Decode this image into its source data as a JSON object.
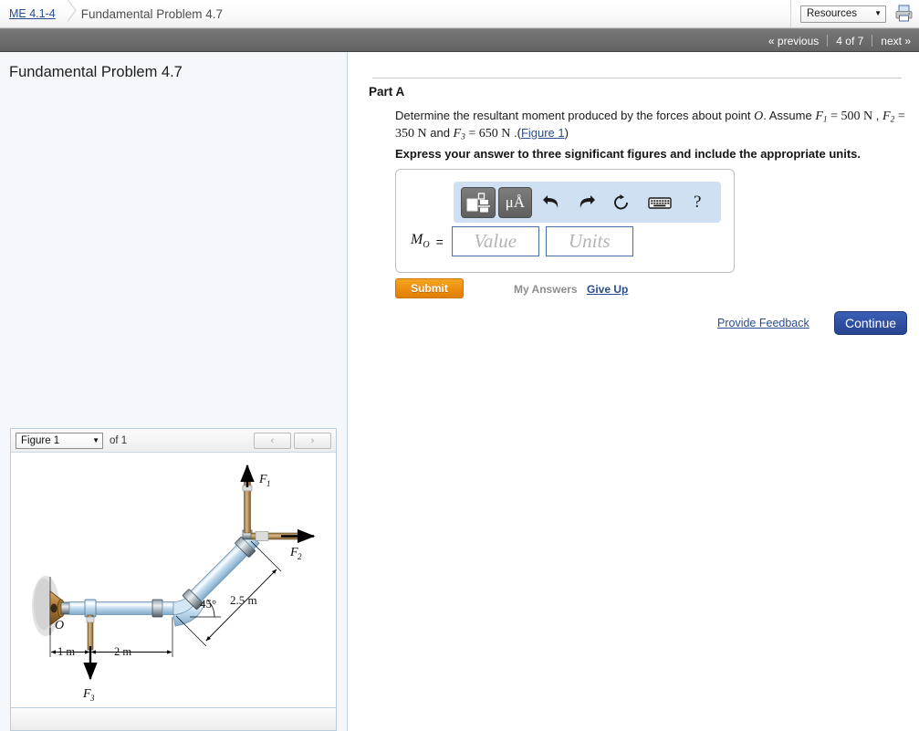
{
  "topbar": {
    "breadcrumb_link": "ME 4.1-4",
    "breadcrumb_current": "Fundamental Problem 4.7",
    "resources_label": "Resources",
    "resources_caret": "▼",
    "print_icon": "printer-icon"
  },
  "navbar": {
    "previous_label": "« previous",
    "page_counter": "4 of 7",
    "next_label": "next »"
  },
  "left": {
    "problem_title": "Fundamental Problem 4.7",
    "figure": {
      "select_value": "Figure 1",
      "select_caret": "▼",
      "of_label": "of 1",
      "prev_arrow": "‹",
      "next_arrow": "›",
      "labels": {
        "point_o": "O",
        "force1": "F",
        "force1_sub": "1",
        "force2": "F",
        "force2_sub": "2",
        "force3": "F",
        "force3_sub": "3",
        "angle": "45°",
        "dim_diagonal": "2.5 m",
        "dim_left": "1 m",
        "dim_mid": "2 m"
      }
    }
  },
  "main": {
    "part_label": "Part A",
    "statement_part1": "Determine the resultant moment produced by the forces about point ",
    "statement_O": "O",
    "statement_part2": ". Assume ",
    "f1_name": "F",
    "f1_sub": "1",
    "f1_eq": " = 500 N",
    "statement_comma": " , ",
    "f2_name": "F",
    "f2_sub": "2",
    "f2_eq": " = 350 N",
    "statement_and": " and ",
    "f3_name": "F",
    "f3_sub": "3",
    "f3_eq": " = 650 N",
    "statement_dot": " .(",
    "figure_link": "Figure 1",
    "statement_close": ")",
    "express_note": "Express your answer to three significant figures and include the appropriate units.",
    "toolbar": {
      "template_button": "math-template-icon",
      "units_button": "μÅ",
      "undo_icon": "undo-icon",
      "redo_icon": "redo-icon",
      "reset_icon": "reset-icon",
      "keyboard_icon": "keyboard-icon",
      "help_icon": "?"
    },
    "answer": {
      "label_M": "M",
      "label_sub": "O",
      "equals": "=",
      "value_placeholder": "Value",
      "units_placeholder": "Units"
    },
    "submit_label": "Submit",
    "my_answers_label": "My Answers",
    "give_up_label": "Give Up",
    "provide_feedback_label": "Provide Feedback",
    "continue_label": "Continue"
  },
  "colors": {
    "accent_blue": "#2a4d8f",
    "submit_orange": "#ee8f10",
    "continue_blue": "#2f51a4",
    "toolbar_blue": "#cfe0f2",
    "panel_bg": "#f4f8fd"
  }
}
